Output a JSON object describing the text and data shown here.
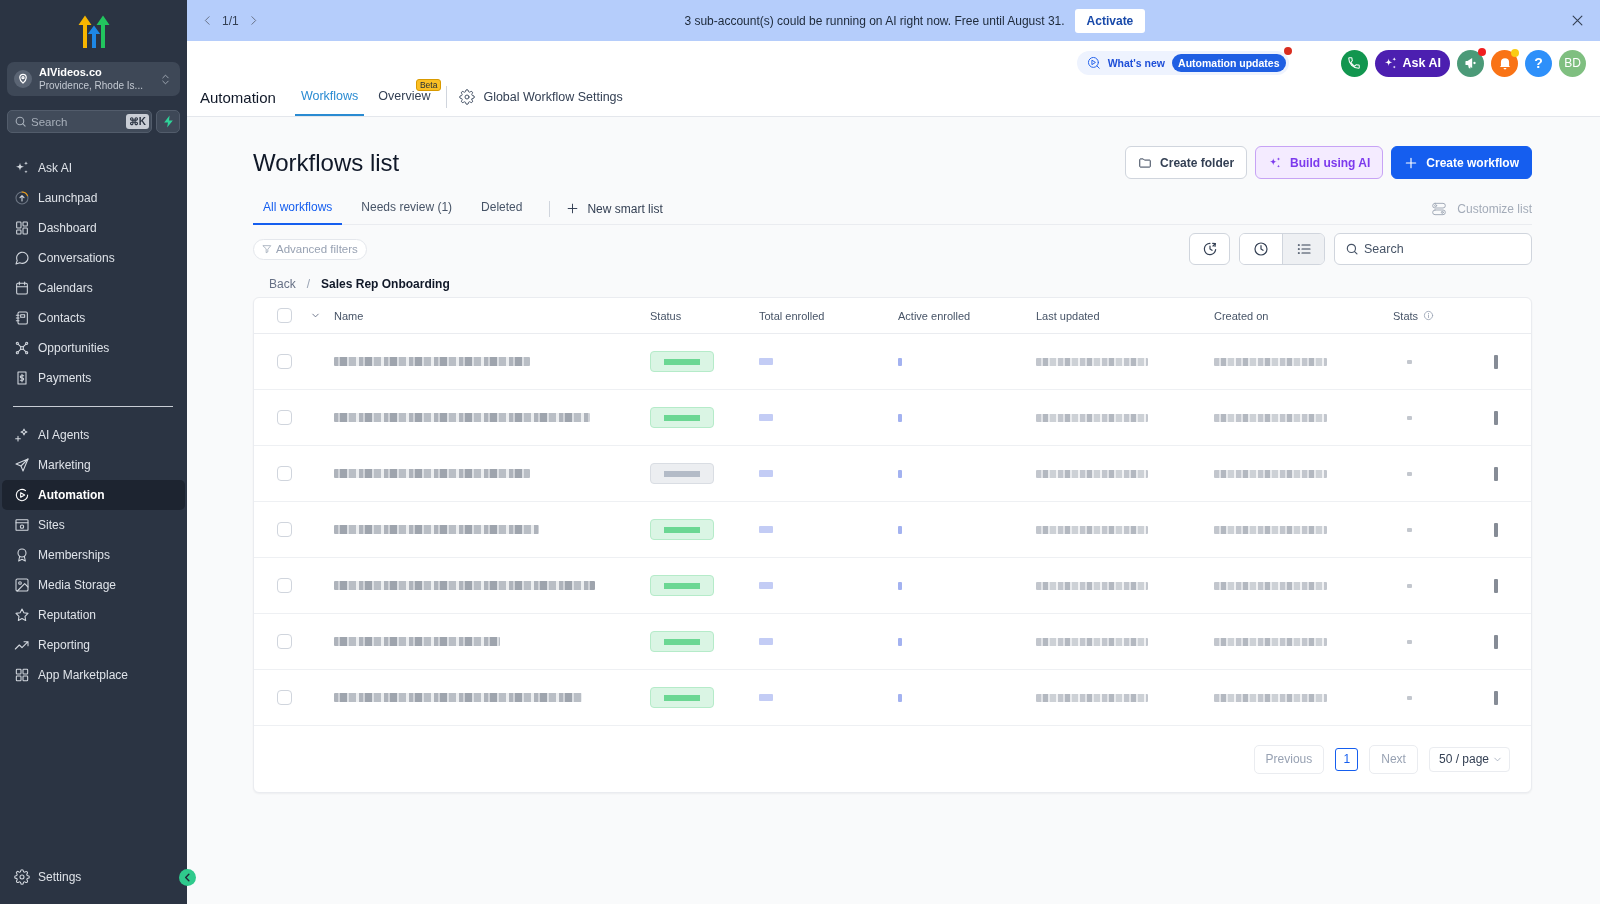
{
  "sidebar": {
    "account": {
      "name": "AIVideos.co",
      "location": "Providence, Rhode Is..."
    },
    "search": {
      "placeholder": "Search",
      "shortcut": "⌘K"
    },
    "sections": [
      {
        "items": [
          {
            "label": "Ask AI",
            "selected": false
          },
          {
            "label": "Launchpad",
            "selected": false
          },
          {
            "label": "Dashboard",
            "selected": false
          },
          {
            "label": "Conversations",
            "selected": false
          },
          {
            "label": "Calendars",
            "selected": false
          },
          {
            "label": "Contacts",
            "selected": false
          },
          {
            "label": "Opportunities",
            "selected": false
          },
          {
            "label": "Payments",
            "selected": false
          }
        ]
      },
      {
        "items": [
          {
            "label": "AI Agents",
            "selected": false
          },
          {
            "label": "Marketing",
            "selected": false
          },
          {
            "label": "Automation",
            "selected": true
          },
          {
            "label": "Sites",
            "selected": false
          },
          {
            "label": "Memberships",
            "selected": false
          },
          {
            "label": "Media Storage",
            "selected": false
          },
          {
            "label": "Reputation",
            "selected": false
          },
          {
            "label": "Reporting",
            "selected": false
          },
          {
            "label": "App Marketplace",
            "selected": false
          }
        ]
      }
    ],
    "settings": {
      "label": "Settings",
      "selected": false
    }
  },
  "banner": {
    "pager": "1/1",
    "message": "3 sub-account(s) could be running on AI right now. Free until August 31.",
    "action": "Activate"
  },
  "header": {
    "title": "Automation",
    "tabs": [
      {
        "label": "Workflows",
        "selected": true
      },
      {
        "label": "Overview",
        "selected": false,
        "badge": "Beta"
      }
    ],
    "settings_link": "Global Workflow Settings",
    "whats_new": {
      "label": "What's new",
      "tag": "Automation updates",
      "unread": true
    },
    "actions": [
      {
        "kind": "phone"
      },
      {
        "kind": "ask_ai",
        "label": "Ask AI"
      },
      {
        "kind": "announcements",
        "unread": true
      },
      {
        "kind": "notifications",
        "unread": true
      },
      {
        "kind": "help",
        "label": "?"
      },
      {
        "kind": "avatar",
        "label": "BD"
      }
    ]
  },
  "page": {
    "title": "Workflows list",
    "actions": [
      {
        "kind": "secondary",
        "label": "Create folder"
      },
      {
        "kind": "ai",
        "label": "Build using AI"
      },
      {
        "kind": "primary",
        "label": "Create workflow"
      }
    ],
    "tabs": [
      {
        "label": "All workflows",
        "selected": true
      },
      {
        "label": "Needs review (1)",
        "selected": false
      },
      {
        "label": "Deleted",
        "selected": false
      }
    ],
    "smart_list": "New smart list",
    "customize": {
      "label": "Customize list",
      "disabled": true
    },
    "filters": {
      "label": "Advanced filters",
      "disabled": true
    },
    "views": [
      {
        "kind": "clock",
        "selected": false
      },
      {
        "kind": "list",
        "selected": true
      }
    ],
    "search": {
      "placeholder": "Search"
    },
    "breadcrumb": {
      "back": "Back",
      "separator": "/",
      "current": "Sales Rep Onboarding"
    }
  },
  "table": {
    "select_all": {
      "checked": false
    },
    "columns": [
      {
        "label": "Name",
        "info": false
      },
      {
        "label": "Status",
        "info": false
      },
      {
        "label": "Total enrolled",
        "info": false
      },
      {
        "label": "Active enrolled",
        "info": false
      },
      {
        "label": "Last updated",
        "info": false
      },
      {
        "label": "Created on",
        "info": false
      },
      {
        "label": "Stats",
        "info": true
      }
    ],
    "rows": [
      {
        "checked": false,
        "color": "#daf5e4"
      },
      {
        "checked": false,
        "color": "#daf5e4"
      },
      {
        "checked": false,
        "color": "#eceef1"
      },
      {
        "checked": false,
        "color": "#daf5e4"
      },
      {
        "checked": false,
        "color": "#daf5e4"
      },
      {
        "checked": false,
        "color": "#daf5e4"
      },
      {
        "checked": false,
        "color": "#daf5e4"
      }
    ]
  },
  "pagination": {
    "previous": {
      "label": "Previous",
      "disabled": true
    },
    "pages": [
      {
        "label": "1",
        "selected": true
      }
    ],
    "next": {
      "label": "Next",
      "disabled": true
    },
    "page_size": "50 / page"
  }
}
